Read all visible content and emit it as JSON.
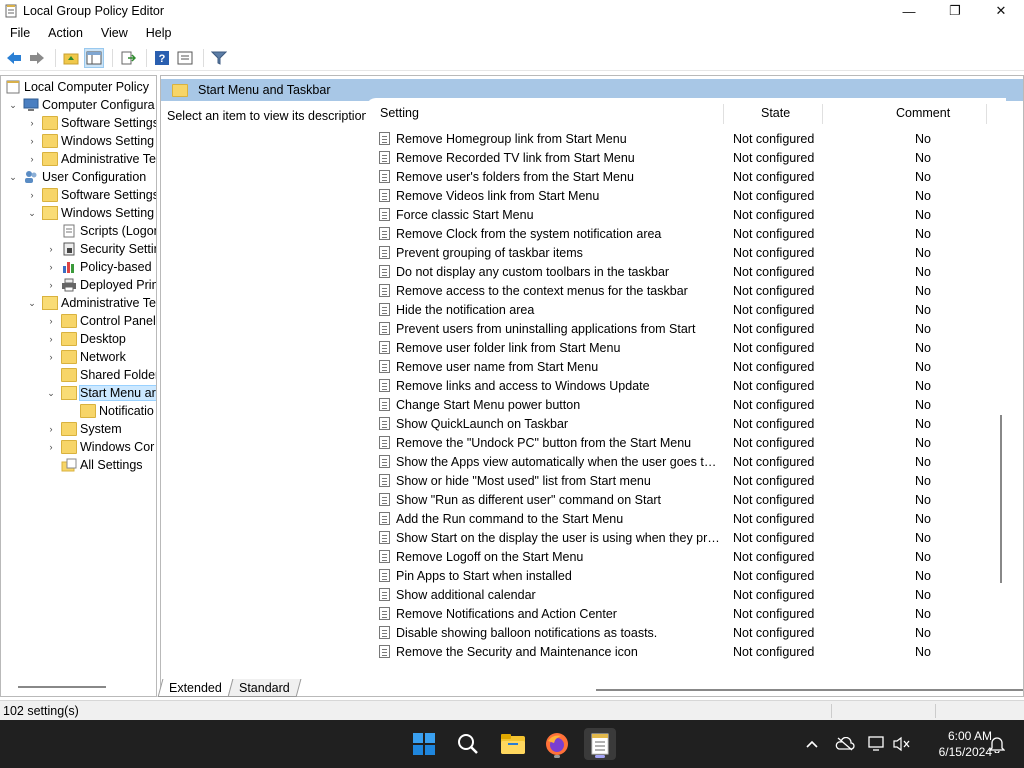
{
  "window": {
    "title": "Local Group Policy Editor",
    "minimize_glyph": "—",
    "maximize_glyph": "❐",
    "close_glyph": "✕"
  },
  "menu": [
    "File",
    "Action",
    "View",
    "Help"
  ],
  "toolbar": {
    "icons": [
      "back-arrow-icon",
      "forward-arrow-icon",
      "up-folder-icon",
      "show-hide-tree-icon",
      "export-list-icon",
      "help-icon",
      "properties-icon",
      "filter-icon"
    ]
  },
  "tree": {
    "root": "Local Computer Policy",
    "computer_configuration": "Computer Configura",
    "cc_software_settings": "Software Settings",
    "cc_windows_settings": "Windows Setting",
    "cc_administrative_templates": "Administrative Te",
    "user_configuration": "User Configuration",
    "uc_software_settings": "Software Settings",
    "uc_windows_settings": "Windows Setting",
    "uc_scripts": "Scripts (Logon",
    "uc_security_settings": "Security Settin",
    "uc_policy_based": "Policy-based",
    "uc_deployed_printers": "Deployed Prin",
    "uc_administrative_templates": "Administrative Te",
    "at_control_panel": "Control Panel",
    "at_desktop": "Desktop",
    "at_network": "Network",
    "at_shared_folders": "Shared Folder",
    "at_start_menu": "Start Menu ar",
    "at_notifications": "Notificatio",
    "at_system": "System",
    "at_windows_components": "Windows Cor",
    "at_all_settings": "All Settings"
  },
  "right_pane": {
    "header_title": "Start Menu and Taskbar",
    "description": "Select an item to view its description.",
    "columns": {
      "setting": "Setting",
      "state": "State",
      "comment": "Comment"
    },
    "rows": [
      {
        "name": "Remove Homegroup link from Start Menu",
        "state": "Not configured",
        "comment": "No"
      },
      {
        "name": "Remove Recorded TV link from Start Menu",
        "state": "Not configured",
        "comment": "No"
      },
      {
        "name": "Remove user's folders from the Start Menu",
        "state": "Not configured",
        "comment": "No"
      },
      {
        "name": "Remove Videos link from Start Menu",
        "state": "Not configured",
        "comment": "No"
      },
      {
        "name": "Force classic Start Menu",
        "state": "Not configured",
        "comment": "No"
      },
      {
        "name": "Remove Clock from the system notification area",
        "state": "Not configured",
        "comment": "No"
      },
      {
        "name": "Prevent grouping of taskbar items",
        "state": "Not configured",
        "comment": "No"
      },
      {
        "name": "Do not display any custom toolbars in the taskbar",
        "state": "Not configured",
        "comment": "No"
      },
      {
        "name": "Remove access to the context menus for the taskbar",
        "state": "Not configured",
        "comment": "No"
      },
      {
        "name": "Hide the notification area",
        "state": "Not configured",
        "comment": "No"
      },
      {
        "name": "Prevent users from uninstalling applications from Start",
        "state": "Not configured",
        "comment": "No"
      },
      {
        "name": "Remove user folder link from Start Menu",
        "state": "Not configured",
        "comment": "No"
      },
      {
        "name": "Remove user name from Start Menu",
        "state": "Not configured",
        "comment": "No"
      },
      {
        "name": "Remove links and access to Windows Update",
        "state": "Not configured",
        "comment": "No"
      },
      {
        "name": "Change Start Menu power button",
        "state": "Not configured",
        "comment": "No"
      },
      {
        "name": "Show QuickLaunch on Taskbar",
        "state": "Not configured",
        "comment": "No"
      },
      {
        "name": "Remove the \"Undock PC\" button from the Start Menu",
        "state": "Not configured",
        "comment": "No"
      },
      {
        "name": "Show the Apps view automatically when the user goes to St...",
        "state": "Not configured",
        "comment": "No"
      },
      {
        "name": "Show or hide \"Most used\" list from Start menu",
        "state": "Not configured",
        "comment": "No"
      },
      {
        "name": "Show \"Run as different user\" command on Start",
        "state": "Not configured",
        "comment": "No"
      },
      {
        "name": "Add the Run command to the Start Menu",
        "state": "Not configured",
        "comment": "No"
      },
      {
        "name": "Show Start on the display the user is using when they press t...",
        "state": "Not configured",
        "comment": "No"
      },
      {
        "name": "Remove Logoff on the Start Menu",
        "state": "Not configured",
        "comment": "No"
      },
      {
        "name": "Pin Apps to Start when installed",
        "state": "Not configured",
        "comment": "No"
      },
      {
        "name": "Show additional calendar",
        "state": "Not configured",
        "comment": "No"
      },
      {
        "name": "Remove Notifications and Action Center",
        "state": "Not configured",
        "comment": "No"
      },
      {
        "name": "Disable showing balloon notifications as toasts.",
        "state": "Not configured",
        "comment": "No"
      },
      {
        "name": "Remove the Security and Maintenance icon",
        "state": "Not configured",
        "comment": "No"
      }
    ]
  },
  "tabs": [
    "Extended",
    "Standard"
  ],
  "status": {
    "text": "102 setting(s)"
  },
  "taskbar": {
    "apps": [
      "start-icon",
      "search-icon",
      "file-explorer-icon",
      "firefox-icon",
      "group-policy-editor-icon"
    ],
    "time": "6:00 AM",
    "date": "6/15/2024"
  }
}
